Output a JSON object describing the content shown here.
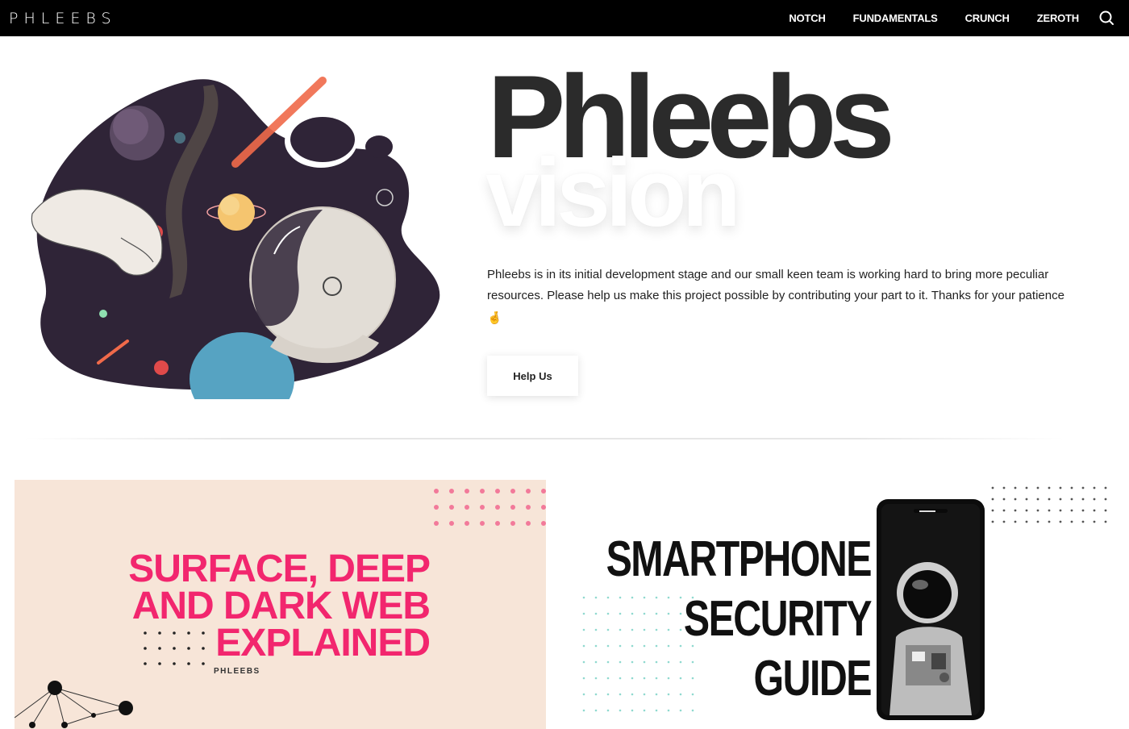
{
  "nav": {
    "logo": "PHLEEBS",
    "links": [
      "NOTCH",
      "FUNDAMENTALS",
      "CRUNCH",
      "ZEROTH"
    ]
  },
  "hero": {
    "title": "Phleebs",
    "subtitle": "vision",
    "description": "Phleebs is in its initial development stage and our small keen team is working hard to bring more peculiar resources. Please help us make this project possible by contributing your part to it. Thanks for your patience",
    "emoji": "🤞",
    "button_label": "Help Us"
  },
  "cards": [
    {
      "title_lines": [
        "SURFACE, DEEP",
        "AND DARK WEB",
        "EXPLAINED"
      ],
      "brand": "PHLEEBS",
      "accent": "#f2266e",
      "background": "#f7e5d8"
    },
    {
      "title_lines": [
        "SMARTPHONE",
        "SECURITY",
        "GUIDE"
      ]
    }
  ],
  "colors": {
    "nav_bg": "#000000",
    "title_color": "#2b2b2b",
    "space_purple": "#2f2437"
  }
}
